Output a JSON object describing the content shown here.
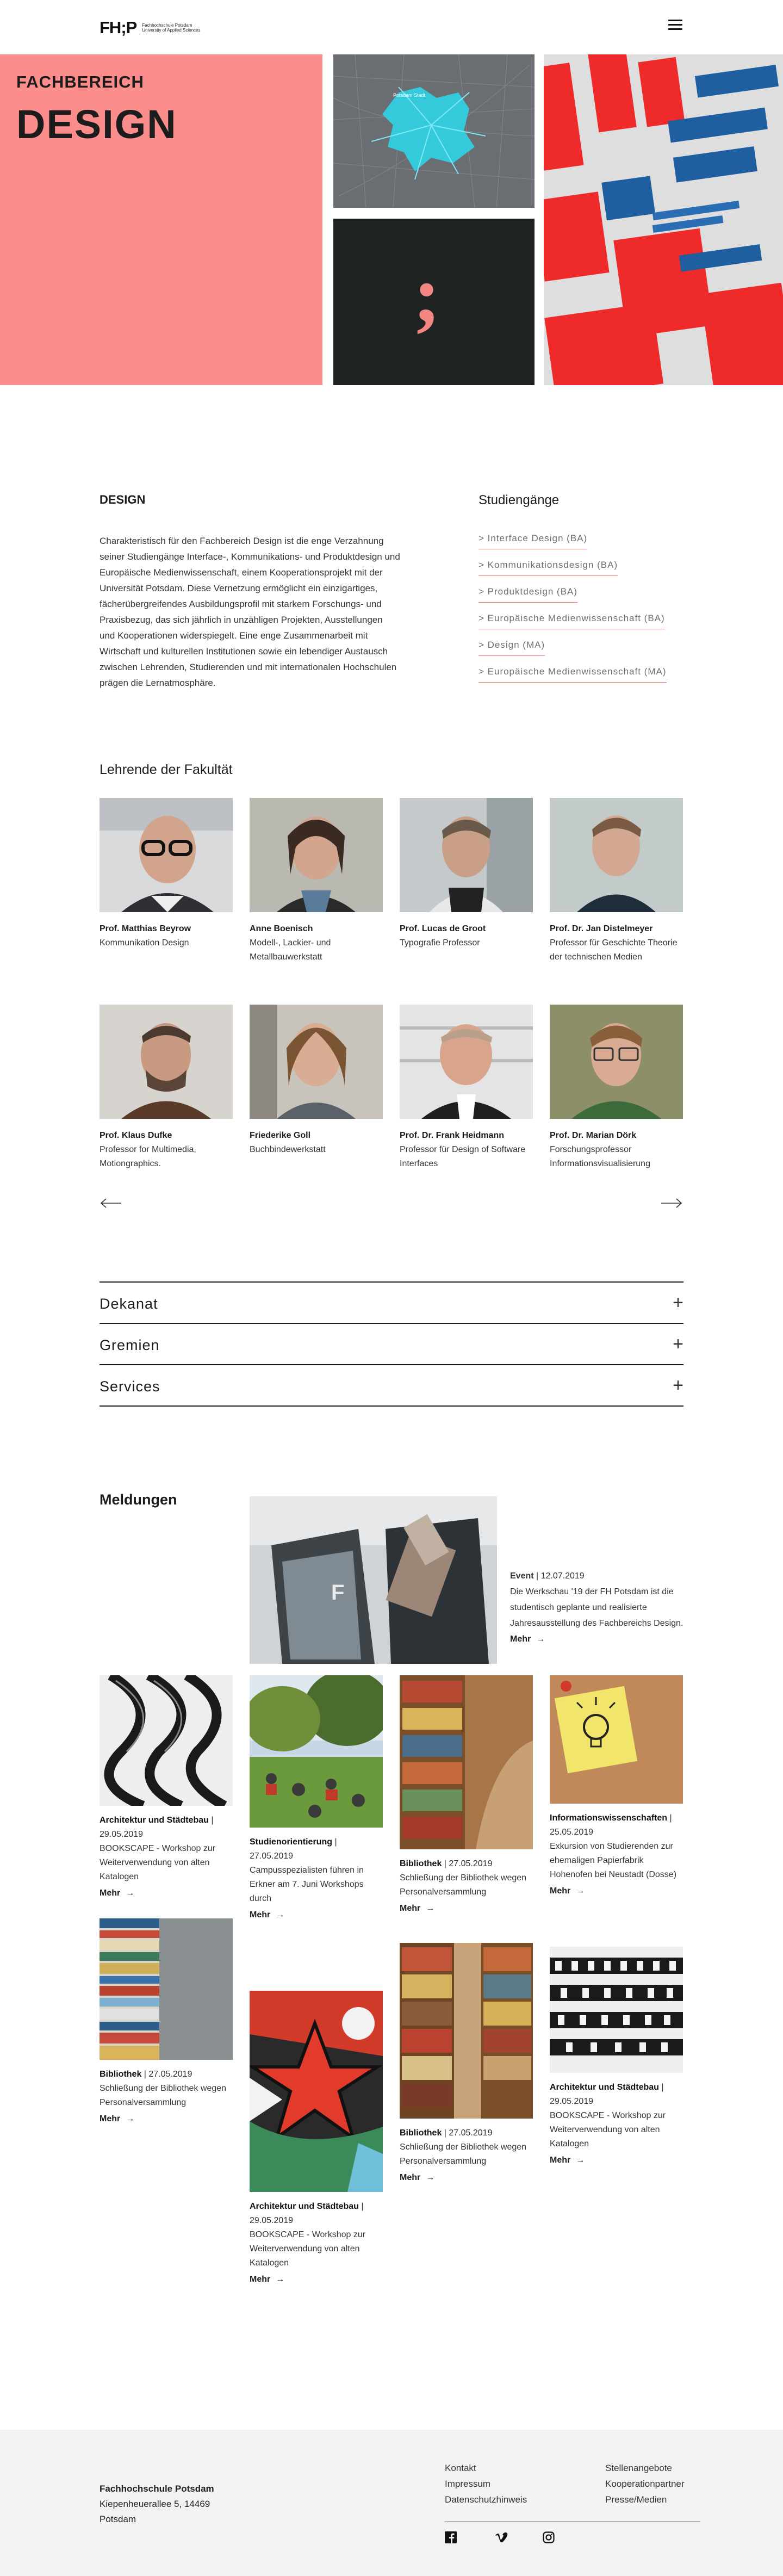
{
  "header": {
    "logo_mark": "FH;P",
    "logo_sub": "Fachhochschule Potsdam University of Applied Sciences"
  },
  "hero": {
    "kicker": "FACHBEREICH",
    "title": "DESIGN",
    "semicolon": ";",
    "map_label": "Potsdam Stadt",
    "colors": {
      "pink": "#fb8d8c",
      "dark": "#1f2321",
      "accent": "#f07a78"
    }
  },
  "intro": {
    "heading": "DESIGN",
    "text": "Charakteristisch für den Fachbereich Design ist die enge Verzahnung seiner Studiengänge Interface-, Kommunikations- und Produktdesign und Europäische Medienwissenschaft, einem Kooperationsprojekt mit der Universität Potsdam. Diese Vernetzung ermöglicht ein einzigartiges, fächerübergreifendes Ausbildungsprofil mit starkem Forschungs- und Praxisbezug, das sich jährlich in unzähligen Projekten, Ausstellungen und Kooperationen widerspiegelt. Eine enge Zusammenarbeit mit Wirtschaft und kulturellen Institutionen sowie ein lebendiger Austausch zwischen Lehrenden, Studierenden und mit internationalen Hochschulen prägen die Lernatmosphäre."
  },
  "studiengaenge": {
    "heading": "Studiengänge",
    "items": [
      "> Interface Design (BA)",
      "> Kommunikationsdesign (BA)",
      "> Produktdesign (BA)",
      "> Europäische Medienwissenschaft (BA)",
      "> Design (MA)",
      "> Europäische Medienwissenschaft (MA)"
    ]
  },
  "lehrende": {
    "heading": "Lehrende der Fakultät",
    "people": [
      {
        "name": "Prof. Matthias Beyrow",
        "role": "Kommunikation Design"
      },
      {
        "name": "Anne Boenisch",
        "role": "Modell-, Lackier- und Metallbauwerkstatt"
      },
      {
        "name": "Prof. Lucas de Groot",
        "role": "Typografie Professor"
      },
      {
        "name": "Prof. Dr. Jan Distelmeyer",
        "role": "Professor für Geschichte Theorie der technischen Medien"
      },
      {
        "name": "Prof. Klaus Dufke",
        "role": "Professor for Multimedia, Motiongraphics."
      },
      {
        "name": "Friederike Goll",
        "role": "Buchbindewerkstatt"
      },
      {
        "name": "Prof. Dr. Frank Heidmann",
        "role": "Professor für Design of Software Interfaces"
      },
      {
        "name": "Prof. Dr. Marian Dörk",
        "role": "Forschungsprofessor Informationsvisualisierung"
      }
    ]
  },
  "accordion": [
    "Dekanat",
    "Gremien",
    "Services"
  ],
  "meldungen": {
    "heading": "Meldungen",
    "more": "Mehr",
    "featured": {
      "category": "Event",
      "date": "12.07.2019",
      "text": "Die Werkschau '19 der FH Potsdam ist die studentisch geplante und realisierte Jahresausstellung des Fachbereichs Design."
    },
    "items": [
      {
        "category": "Architektur und Städtebau",
        "date": "29.05.2019",
        "text": "BOOKSCAPE - Workshop zur Weiterverwendung von alten Katalogen"
      },
      {
        "category": "Studienorientierung",
        "date": "27.05.2019",
        "text": "Campusspezialisten führen in Erkner am 7. Juni Workshops durch"
      },
      {
        "category": "Bibliothek",
        "date": "27.05.2019",
        "text": "Schließung der Bibliothek wegen Personalversammlung"
      },
      {
        "category": "Informationswissenschaften",
        "date": "25.05.2019",
        "text": "Exkursion von Studierenden zur ehemaligen Papierfabrik Hohenofen bei Neustadt (Dosse)"
      },
      {
        "category": "Bibliothek",
        "date": "27.05.2019",
        "text": "Schließung der Bibliothek wegen Personalversammlung"
      },
      {
        "category": "Architektur und Städtebau",
        "date": "29.05.2019",
        "text": "BOOKSCAPE - Workshop zur Weiterverwendung von alten Katalogen"
      },
      {
        "category": "Bibliothek",
        "date": "27.05.2019",
        "text": "Schließung der Bibliothek wegen Personalversammlung"
      },
      {
        "category": "Architektur und Städtebau",
        "date": "29.05.2019",
        "text": "BOOKSCAPE - Workshop zur Weiterverwendung von alten Katalogen"
      }
    ]
  },
  "footer": {
    "name": "Fachhochschule Potsdam",
    "street": "Kiepenheuerallee 5, 14469",
    "city": "Potsdam",
    "links_col1": [
      "Kontakt",
      "Impressum",
      "Datenschutzhinweis"
    ],
    "links_col2": [
      "Stellenangebote",
      "Kooperationpartner",
      "Presse/Medien"
    ],
    "social_icons": [
      "facebook-icon",
      "vimeo-icon",
      "instagram-icon"
    ]
  }
}
